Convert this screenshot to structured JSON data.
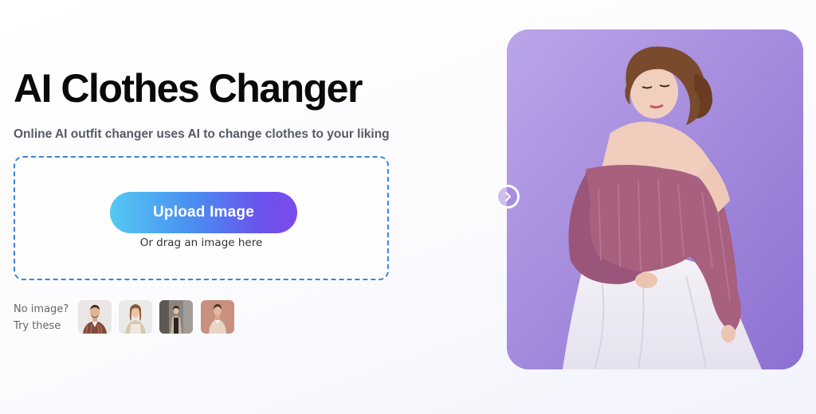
{
  "hero": {
    "title": "AI Clothes Changer",
    "subtitle": "Online AI outfit changer uses AI to change clothes to your liking"
  },
  "upload": {
    "button_label": "Upload Image",
    "drag_hint": "Or drag an image here"
  },
  "samples": {
    "label_line1": "No image?",
    "label_line2": "Try these",
    "thumbnails": [
      {
        "icon": "man-plaid-shirt-thumbnail"
      },
      {
        "icon": "woman-beige-outfit-thumbnail"
      },
      {
        "icon": "woman-street-coat-thumbnail"
      },
      {
        "icon": "man-casual-thumbnail"
      }
    ]
  },
  "preview": {
    "image": "woman-pink-sweater-preview",
    "handle_icon": "chevron-right-icon"
  },
  "colors": {
    "accent_start": "#54c9f3",
    "accent_end": "#7b4bea",
    "dropzone_border": "#3a86d6",
    "preview_background": "#9d82da"
  }
}
